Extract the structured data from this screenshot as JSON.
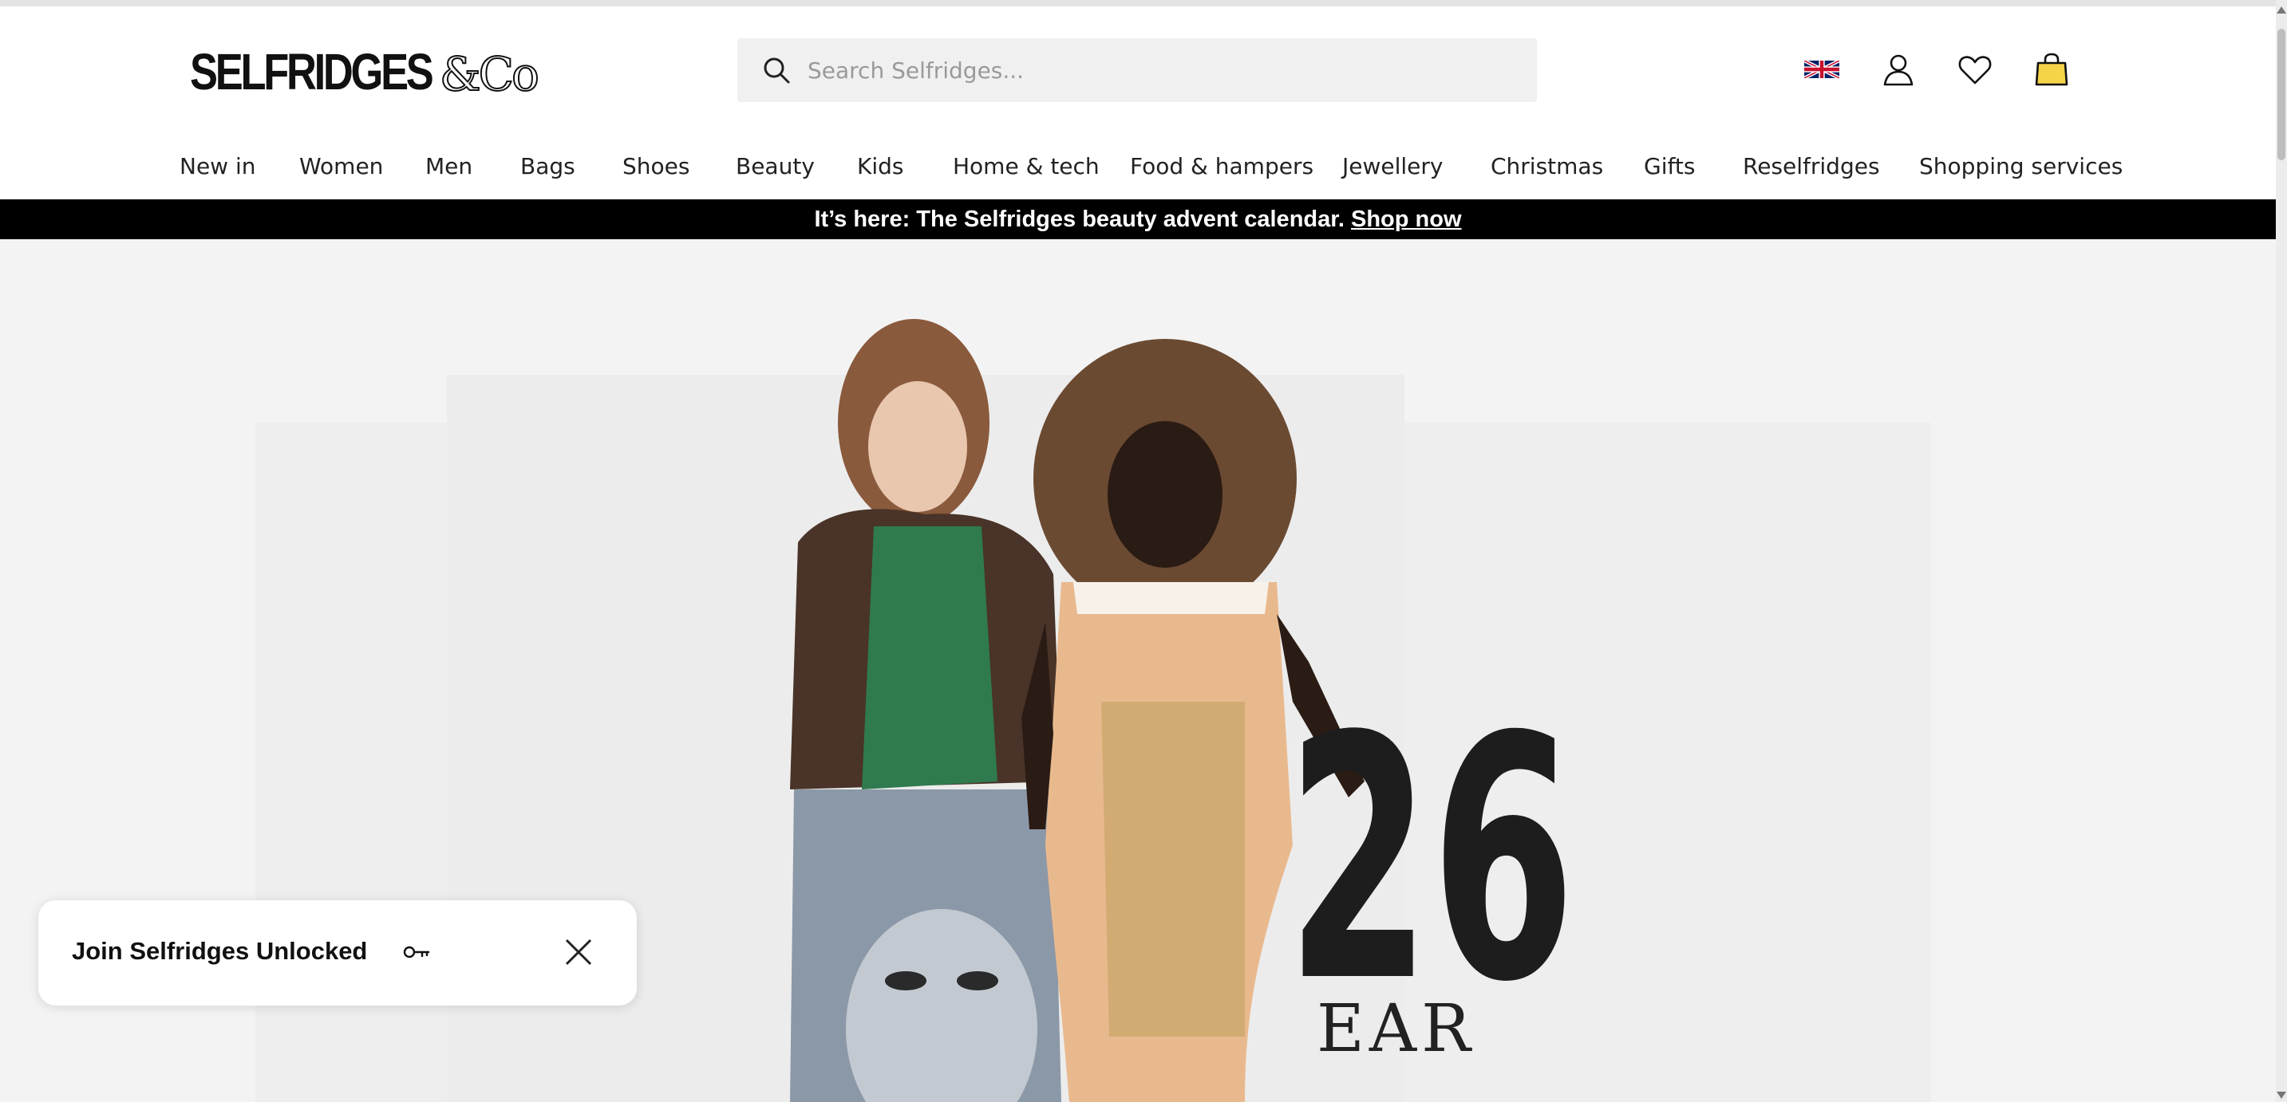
{
  "header": {
    "logo_text": "SELFRIDGES",
    "logo_suffix": "&Co",
    "search_placeholder": "Search Selfridges..."
  },
  "icons": {
    "search": "search-icon",
    "flag": "uk-flag-icon",
    "account": "user-icon",
    "wishlist": "heart-icon",
    "bag": "shopping-bag-icon",
    "key": "key-icon",
    "close": "close-icon"
  },
  "nav": {
    "items": [
      {
        "label": "New in"
      },
      {
        "label": "Women"
      },
      {
        "label": "Men"
      },
      {
        "label": "Bags"
      },
      {
        "label": "Shoes"
      },
      {
        "label": "Beauty"
      },
      {
        "label": "Kids"
      },
      {
        "label": "Home & tech"
      },
      {
        "label": "Food & hampers"
      },
      {
        "label": "Jewellery"
      },
      {
        "label": "Christmas"
      },
      {
        "label": "Gifts"
      },
      {
        "label": "Reselfridges"
      },
      {
        "label": "Shopping services"
      }
    ]
  },
  "promo": {
    "text": "It’s here: The Selfridges beauty advent calendar.",
    "link": "Shop now"
  },
  "hero": {
    "number_fragment": "26",
    "word_fragment": "EAR"
  },
  "popup": {
    "text": "Join Selfridges Unlocked"
  },
  "colors": {
    "promo_bg": "#000000",
    "hero_bg": "#f3f3f3",
    "bag_yellow": "#f5d44a",
    "search_bg": "#f0f0f0"
  }
}
